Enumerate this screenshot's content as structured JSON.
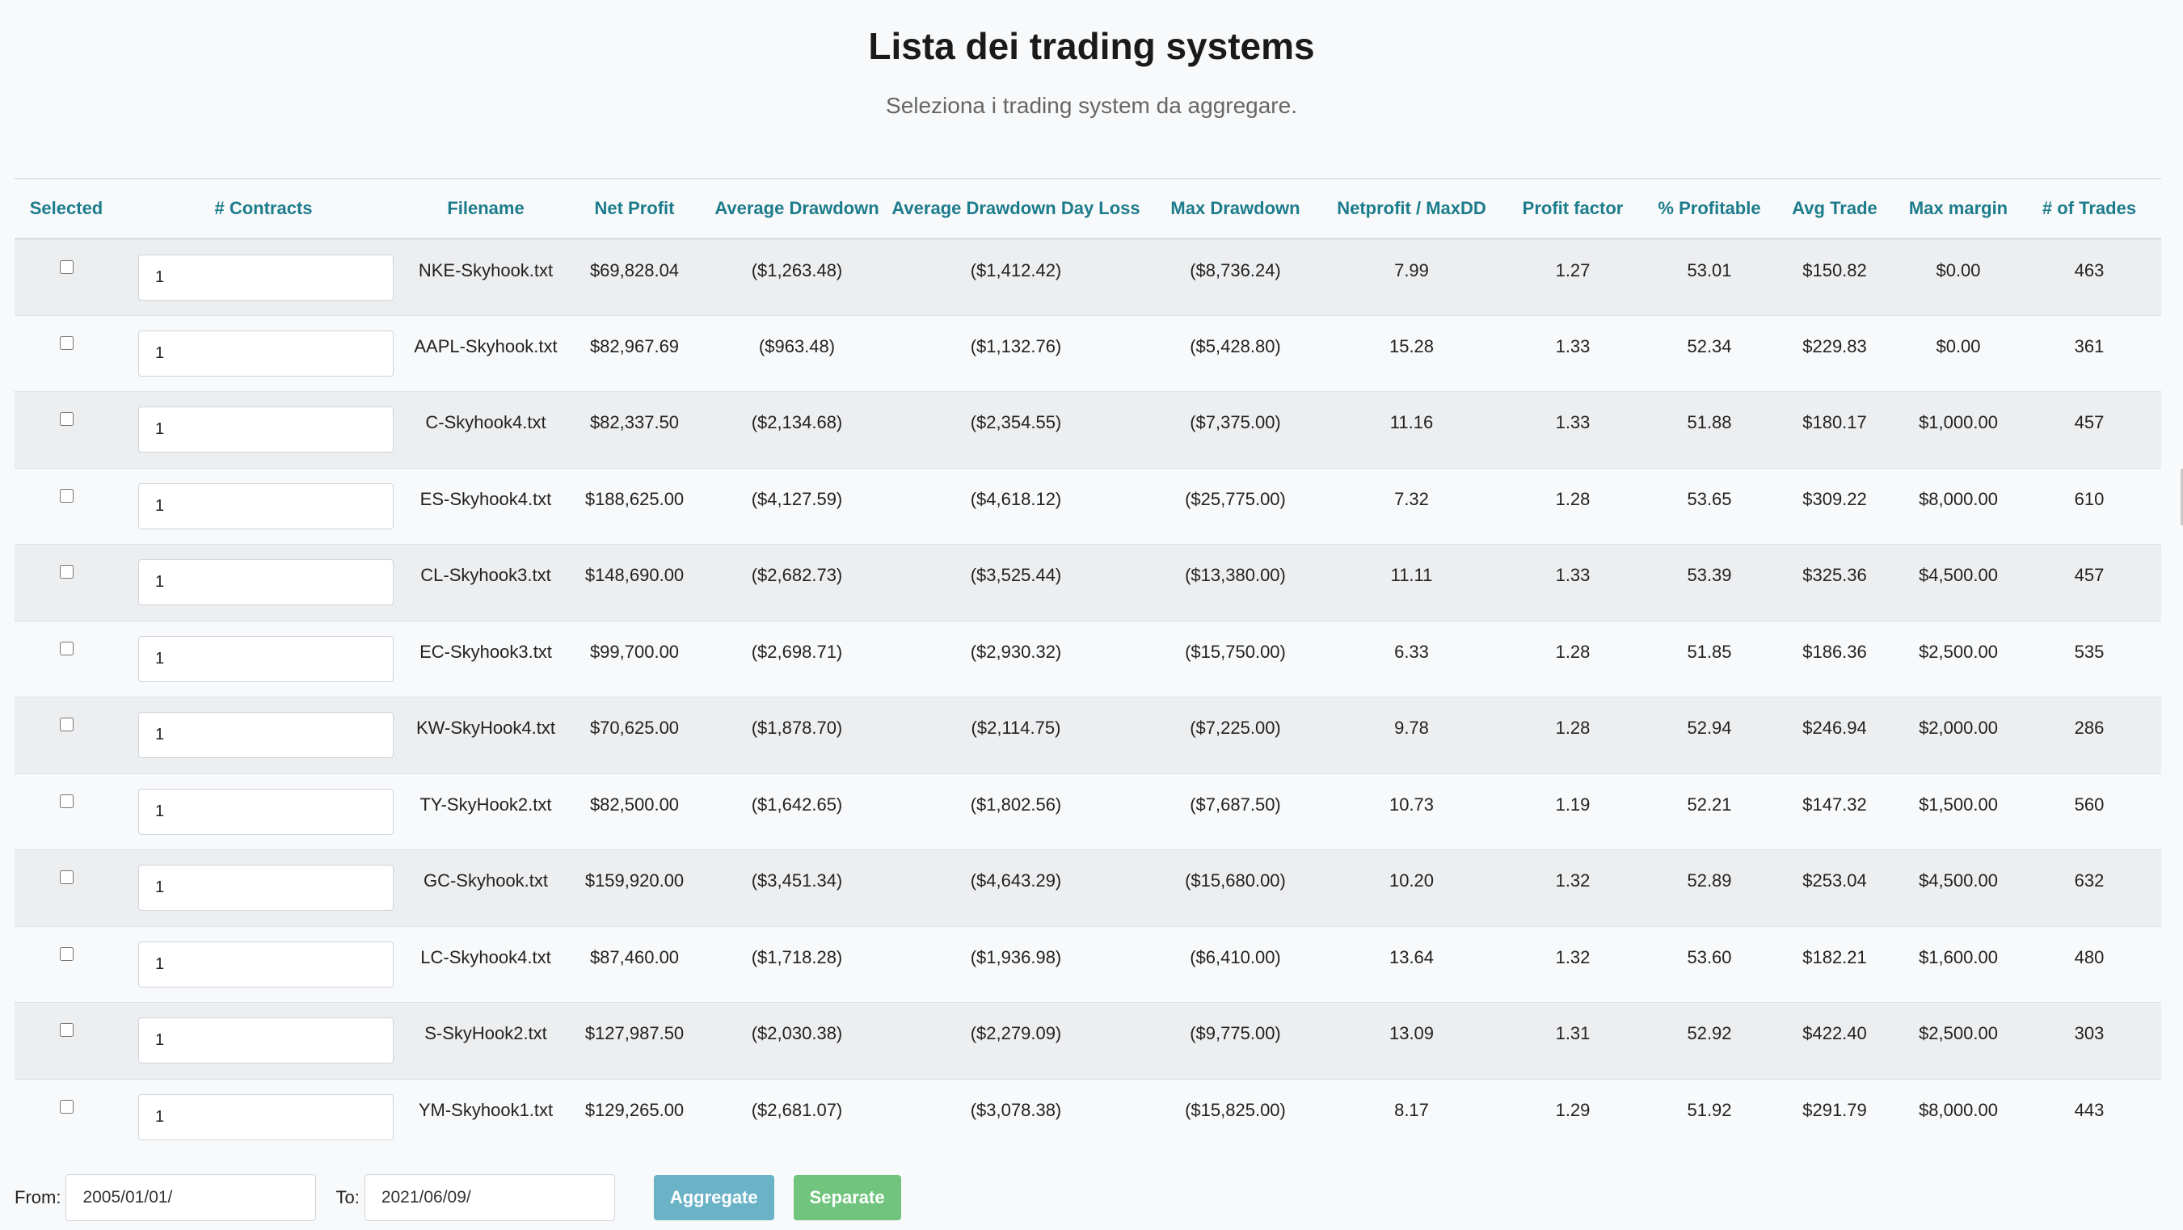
{
  "header": {
    "title": "Lista dei trading systems",
    "subtitle": "Seleziona i trading system da aggregare."
  },
  "table": {
    "columns": [
      "Selected",
      "# Contracts",
      "Filename",
      "Net Profit",
      "Average Drawdown",
      "Average Drawdown Day Loss",
      "Max Drawdown",
      "Netprofit / MaxDD",
      "Profit factor",
      "% Profitable",
      "Avg Trade",
      "Max margin",
      "# of Trades"
    ],
    "rows": [
      {
        "contracts": "1",
        "filename": "NKE-Skyhook.txt",
        "net_profit": "$69,828.04",
        "avg_drawdown": "($1,263.48)",
        "avg_dd_day_loss": "($1,412.42)",
        "max_drawdown": "($8,736.24)",
        "np_maxdd": "7.99",
        "profit_factor": "1.27",
        "pct_profitable": "53.01",
        "avg_trade": "$150.82",
        "max_margin": "$0.00",
        "trades": "463"
      },
      {
        "contracts": "1",
        "filename": "AAPL-Skyhook.txt",
        "net_profit": "$82,967.69",
        "avg_drawdown": "($963.48)",
        "avg_dd_day_loss": "($1,132.76)",
        "max_drawdown": "($5,428.80)",
        "np_maxdd": "15.28",
        "profit_factor": "1.33",
        "pct_profitable": "52.34",
        "avg_trade": "$229.83",
        "max_margin": "$0.00",
        "trades": "361"
      },
      {
        "contracts": "1",
        "filename": "C-Skyhook4.txt",
        "net_profit": "$82,337.50",
        "avg_drawdown": "($2,134.68)",
        "avg_dd_day_loss": "($2,354.55)",
        "max_drawdown": "($7,375.00)",
        "np_maxdd": "11.16",
        "profit_factor": "1.33",
        "pct_profitable": "51.88",
        "avg_trade": "$180.17",
        "max_margin": "$1,000.00",
        "trades": "457"
      },
      {
        "contracts": "1",
        "filename": "ES-Skyhook4.txt",
        "net_profit": "$188,625.00",
        "avg_drawdown": "($4,127.59)",
        "avg_dd_day_loss": "($4,618.12)",
        "max_drawdown": "($25,775.00)",
        "np_maxdd": "7.32",
        "profit_factor": "1.28",
        "pct_profitable": "53.65",
        "avg_trade": "$309.22",
        "max_margin": "$8,000.00",
        "trades": "610"
      },
      {
        "contracts": "1",
        "filename": "CL-Skyhook3.txt",
        "net_profit": "$148,690.00",
        "avg_drawdown": "($2,682.73)",
        "avg_dd_day_loss": "($3,525.44)",
        "max_drawdown": "($13,380.00)",
        "np_maxdd": "11.11",
        "profit_factor": "1.33",
        "pct_profitable": "53.39",
        "avg_trade": "$325.36",
        "max_margin": "$4,500.00",
        "trades": "457"
      },
      {
        "contracts": "1",
        "filename": "EC-Skyhook3.txt",
        "net_profit": "$99,700.00",
        "avg_drawdown": "($2,698.71)",
        "avg_dd_day_loss": "($2,930.32)",
        "max_drawdown": "($15,750.00)",
        "np_maxdd": "6.33",
        "profit_factor": "1.28",
        "pct_profitable": "51.85",
        "avg_trade": "$186.36",
        "max_margin": "$2,500.00",
        "trades": "535"
      },
      {
        "contracts": "1",
        "filename": "KW-SkyHook4.txt",
        "net_profit": "$70,625.00",
        "avg_drawdown": "($1,878.70)",
        "avg_dd_day_loss": "($2,114.75)",
        "max_drawdown": "($7,225.00)",
        "np_maxdd": "9.78",
        "profit_factor": "1.28",
        "pct_profitable": "52.94",
        "avg_trade": "$246.94",
        "max_margin": "$2,000.00",
        "trades": "286"
      },
      {
        "contracts": "1",
        "filename": "TY-SkyHook2.txt",
        "net_profit": "$82,500.00",
        "avg_drawdown": "($1,642.65)",
        "avg_dd_day_loss": "($1,802.56)",
        "max_drawdown": "($7,687.50)",
        "np_maxdd": "10.73",
        "profit_factor": "1.19",
        "pct_profitable": "52.21",
        "avg_trade": "$147.32",
        "max_margin": "$1,500.00",
        "trades": "560"
      },
      {
        "contracts": "1",
        "filename": "GC-Skyhook.txt",
        "net_profit": "$159,920.00",
        "avg_drawdown": "($3,451.34)",
        "avg_dd_day_loss": "($4,643.29)",
        "max_drawdown": "($15,680.00)",
        "np_maxdd": "10.20",
        "profit_factor": "1.32",
        "pct_profitable": "52.89",
        "avg_trade": "$253.04",
        "max_margin": "$4,500.00",
        "trades": "632"
      },
      {
        "contracts": "1",
        "filename": "LC-Skyhook4.txt",
        "net_profit": "$87,460.00",
        "avg_drawdown": "($1,718.28)",
        "avg_dd_day_loss": "($1,936.98)",
        "max_drawdown": "($6,410.00)",
        "np_maxdd": "13.64",
        "profit_factor": "1.32",
        "pct_profitable": "53.60",
        "avg_trade": "$182.21",
        "max_margin": "$1,600.00",
        "trades": "480"
      },
      {
        "contracts": "1",
        "filename": "S-SkyHook2.txt",
        "net_profit": "$127,987.50",
        "avg_drawdown": "($2,030.38)",
        "avg_dd_day_loss": "($2,279.09)",
        "max_drawdown": "($9,775.00)",
        "np_maxdd": "13.09",
        "profit_factor": "1.31",
        "pct_profitable": "52.92",
        "avg_trade": "$422.40",
        "max_margin": "$2,500.00",
        "trades": "303"
      },
      {
        "contracts": "1",
        "filename": "YM-Skyhook1.txt",
        "net_profit": "$129,265.00",
        "avg_drawdown": "($2,681.07)",
        "avg_dd_day_loss": "($3,078.38)",
        "max_drawdown": "($15,825.00)",
        "np_maxdd": "8.17",
        "profit_factor": "1.29",
        "pct_profitable": "51.92",
        "avg_trade": "$291.79",
        "max_margin": "$8,000.00",
        "trades": "443"
      }
    ]
  },
  "footer": {
    "from_label": "From:",
    "from_value": "2005/01/01/",
    "to_label": "To:",
    "to_value": "2021/06/09/",
    "aggregate_label": "Aggregate",
    "separate_label": "Separate"
  },
  "colors": {
    "header_text": "#1c7c8c",
    "aggregate_button": "#6ab2c6",
    "separate_button": "#71c47d"
  }
}
